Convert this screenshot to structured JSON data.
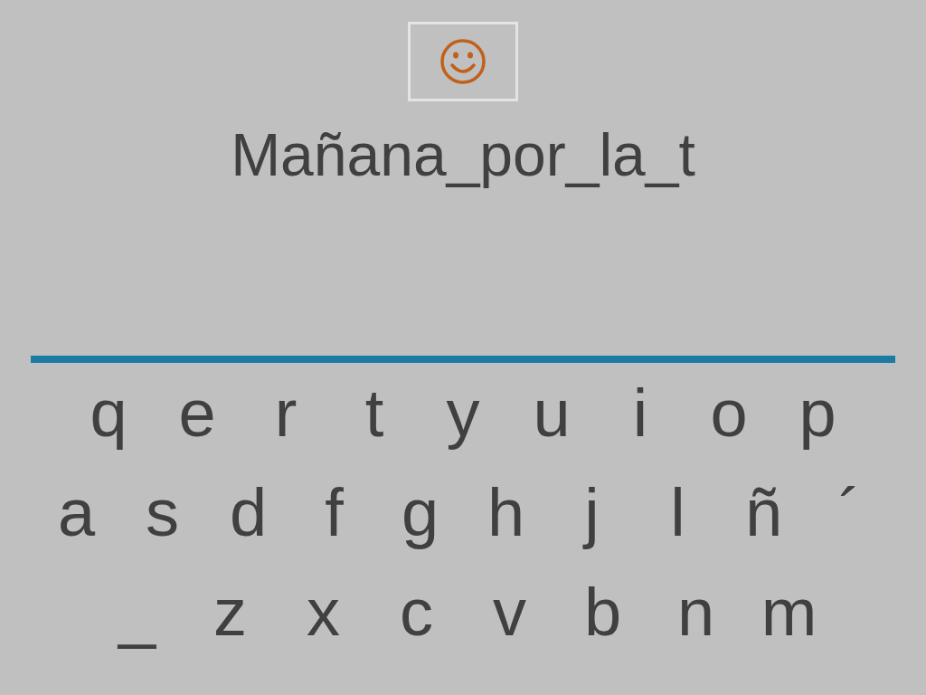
{
  "phrase": "Mañana_por_la_t",
  "keyboard": {
    "rows": [
      [
        "q",
        "e",
        "r",
        "t",
        "y",
        "u",
        "i",
        "o",
        "p"
      ],
      [
        "a",
        "s",
        "d",
        "f",
        "g",
        "h",
        "j",
        "l",
        "ñ",
        "´"
      ],
      [
        "_",
        "z",
        "x",
        "c",
        "v",
        "b",
        "n",
        "m"
      ]
    ]
  }
}
